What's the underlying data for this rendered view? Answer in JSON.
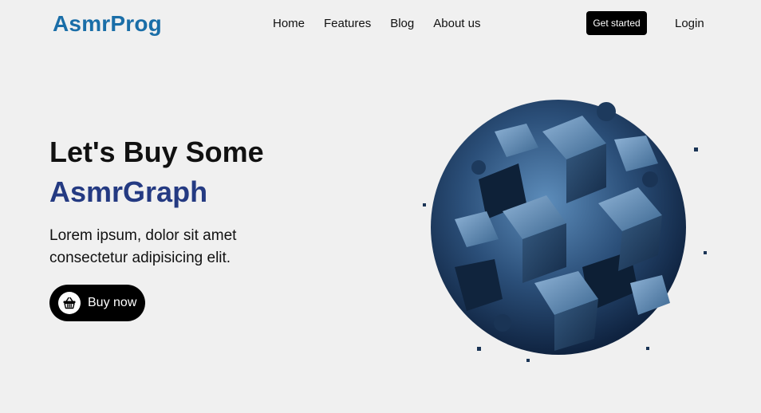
{
  "brand": {
    "name": "AsmrProg",
    "color": "#1a6ea8"
  },
  "nav": {
    "links": [
      "Home",
      "Features",
      "Blog",
      "About us"
    ],
    "cta_label": "Get started",
    "login_label": "Login"
  },
  "hero": {
    "title": "Let's Buy Some",
    "highlight": "AsmrGraph",
    "highlight_color": "#243a82",
    "description": "Lorem ipsum, dolor sit amet consectetur adipisicing elit.",
    "button_label": "Buy now",
    "button_icon": "basket-icon",
    "image_subject": "abstract-blue-cube-sphere"
  }
}
